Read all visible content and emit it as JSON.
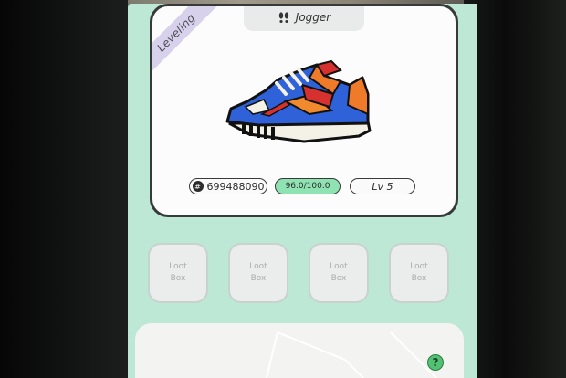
{
  "ribbon": {
    "label": "Leveling"
  },
  "sneaker": {
    "type_label": "Jogger",
    "type_icon": "feet-icon",
    "image": "sneaker-image"
  },
  "stats": {
    "sneaker_id": "699488090",
    "durability": "96.0/100.0",
    "level": "Lv 5"
  },
  "loot_boxes": [
    {
      "label": "Loot\nBox"
    },
    {
      "label": "Loot\nBox"
    },
    {
      "label": "Loot\nBox"
    },
    {
      "label": "Loot\nBox"
    }
  ],
  "help": {
    "label": "?"
  },
  "colors": {
    "background": "#bde8d6",
    "card_border": "#373a38",
    "durability_fill": "#8fe2b2",
    "help_button": "#53c173"
  }
}
